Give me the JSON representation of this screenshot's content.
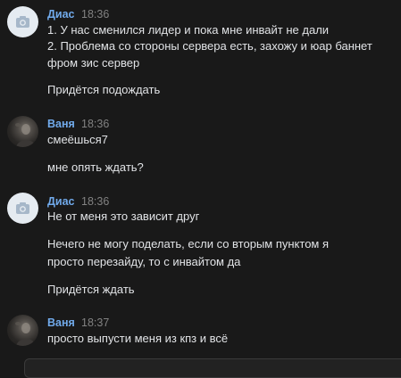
{
  "messages": [
    {
      "author": "Диас",
      "time": "18:36",
      "avatar": "default-camera-avatar",
      "lines": [
        "1. У нас сменился лидер и пока мне инвайт не дали",
        "2. Проблема со стороны сервера есть, захожу и юар баннет",
        "фром зис сервер",
        "Придётся подождать"
      ]
    },
    {
      "author": "Ваня",
      "time": "18:36",
      "avatar": "photo-avatar",
      "lines": [
        "смеёшься7",
        "мне опять ждать?"
      ]
    },
    {
      "author": "Диас",
      "time": "18:36",
      "avatar": "default-camera-avatar",
      "lines": [
        "Не от меня это зависит друг",
        "Нечего не могу поделать, если со вторым пунктом я",
        "просто перезайду, то с инвайтом да",
        "Придётся ждать"
      ]
    },
    {
      "author": "Ваня",
      "time": "18:37",
      "avatar": "photo-avatar",
      "lines": [
        "просто выпусти меня из кпз и всё"
      ]
    }
  ],
  "colors": {
    "background": "#191919",
    "author_name": "#71aaeb",
    "timestamp": "#828282",
    "text": "#e1e3e6"
  }
}
